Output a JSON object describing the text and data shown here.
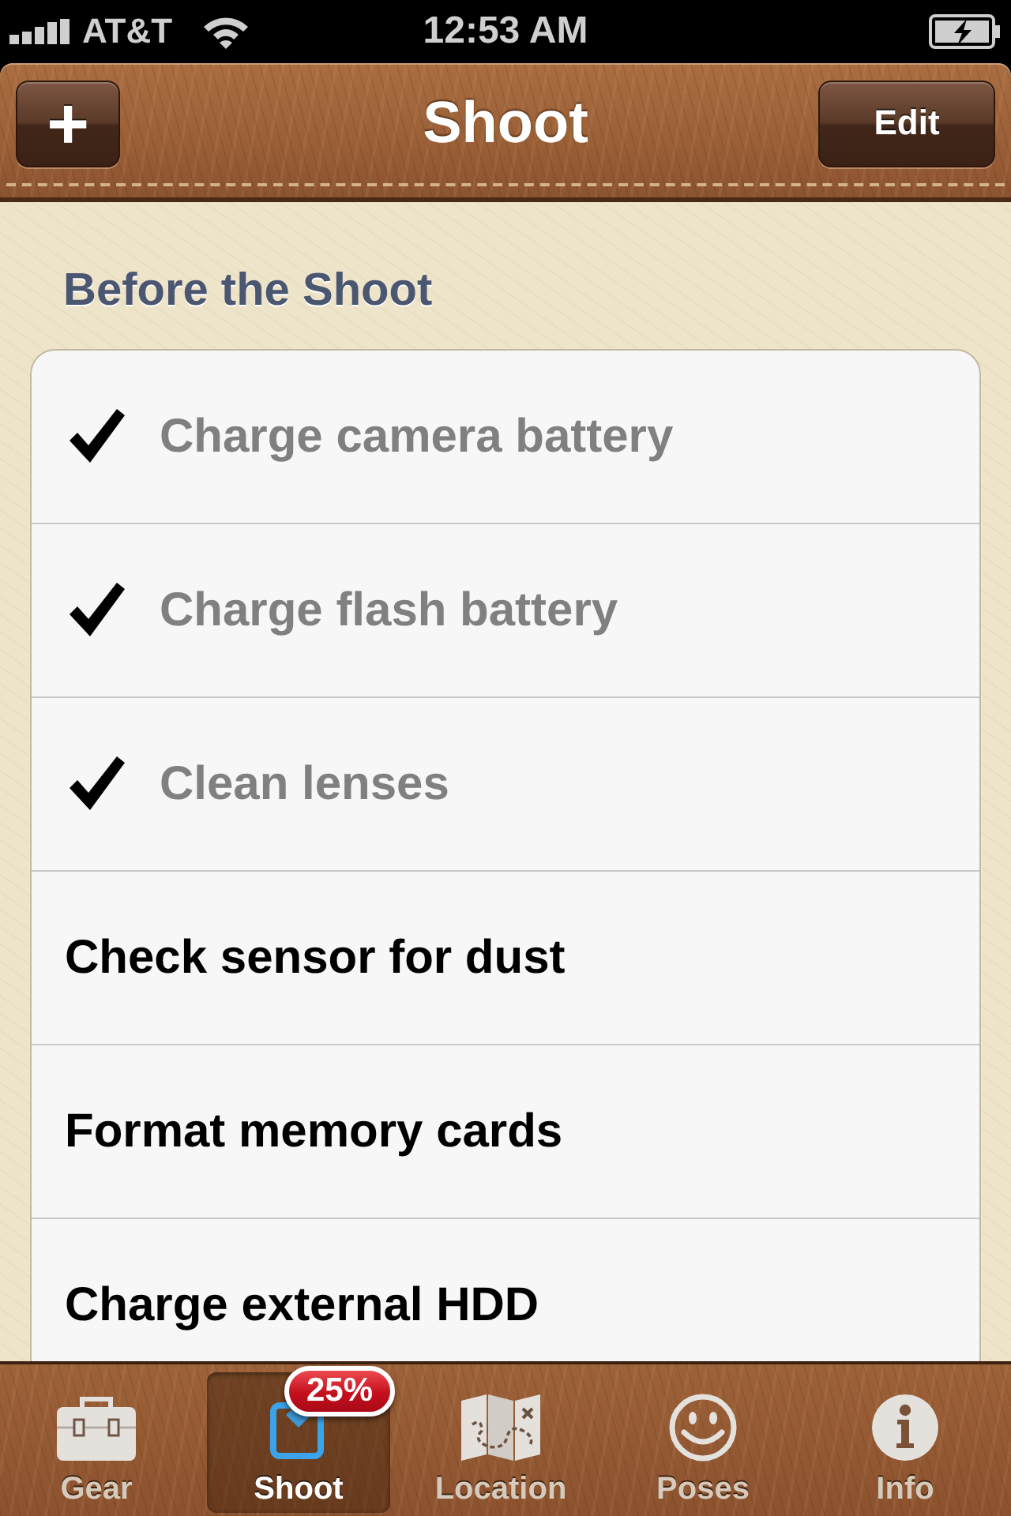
{
  "status_bar": {
    "carrier": "AT&T",
    "time": "12:53 AM"
  },
  "nav_bar": {
    "title": "Shoot",
    "add_button": "+",
    "edit_button": "Edit"
  },
  "section": {
    "title": "Before the Shoot"
  },
  "items": [
    {
      "label": "Charge camera battery",
      "checked": true
    },
    {
      "label": "Charge flash battery",
      "checked": true
    },
    {
      "label": "Clean lenses",
      "checked": true
    },
    {
      "label": "Check sensor for dust",
      "checked": false
    },
    {
      "label": "Format memory cards",
      "checked": false
    },
    {
      "label": "Charge external HDD",
      "checked": false
    }
  ],
  "tab_bar": [
    {
      "label": "Gear",
      "kind": "toolbox",
      "selected": false
    },
    {
      "label": "Shoot",
      "kind": "checklist",
      "selected": true,
      "badge": "25%"
    },
    {
      "label": "Location",
      "kind": "map",
      "selected": false
    },
    {
      "label": "Poses",
      "kind": "smiley",
      "selected": false
    },
    {
      "label": "Info",
      "kind": "info",
      "selected": false
    }
  ]
}
